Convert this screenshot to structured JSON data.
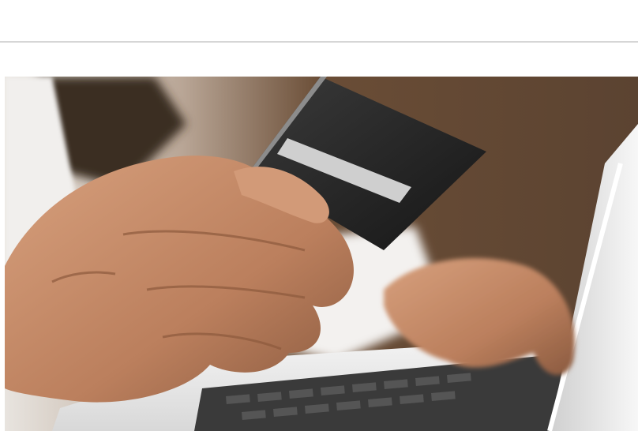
{
  "page": {
    "background": "#ffffff",
    "divider_color": "#d6d6d6"
  },
  "hero_image": {
    "subject": "hand-holding-credit-card-over-laptop-keyboard",
    "colors": {
      "backdrop": "#5b4331",
      "skin": "#c98f6e",
      "card": "#2a2a2a",
      "laptop": "#e9e9e9",
      "keyboard": "#3a3a3a"
    }
  }
}
